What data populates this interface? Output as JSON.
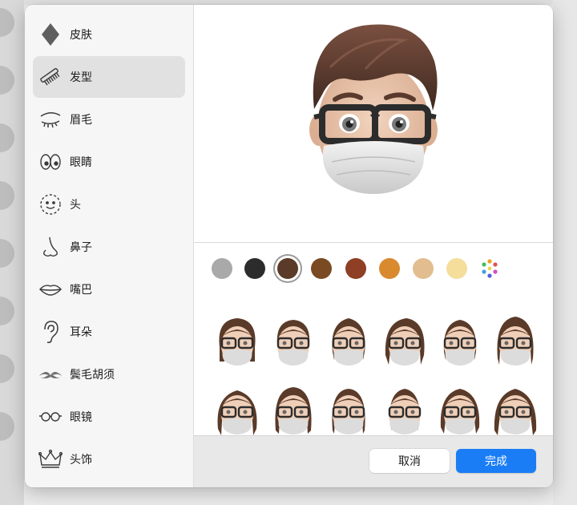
{
  "sidebar": {
    "items": [
      {
        "label": "皮肤",
        "icon": "skin-diamond-icon"
      },
      {
        "label": "发型",
        "icon": "comb-icon"
      },
      {
        "label": "眉毛",
        "icon": "eyebrow-icon"
      },
      {
        "label": "眼睛",
        "icon": "eyes-icon"
      },
      {
        "label": "头",
        "icon": "head-icon"
      },
      {
        "label": "鼻子",
        "icon": "nose-icon"
      },
      {
        "label": "嘴巴",
        "icon": "mouth-icon"
      },
      {
        "label": "耳朵",
        "icon": "ear-icon"
      },
      {
        "label": "鬓毛胡须",
        "icon": "mustache-icon"
      },
      {
        "label": "眼镜",
        "icon": "glasses-icon"
      },
      {
        "label": "头饰",
        "icon": "crown-icon"
      }
    ],
    "selected": "发型"
  },
  "hair_colors": [
    {
      "name": "gray",
      "hex": "#a9a9a9"
    },
    {
      "name": "black",
      "hex": "#2c2c2c"
    },
    {
      "name": "dark-brown",
      "hex": "#5a3a28",
      "selected": true
    },
    {
      "name": "brown",
      "hex": "#7a4a22"
    },
    {
      "name": "auburn",
      "hex": "#8e3f24"
    },
    {
      "name": "orange",
      "hex": "#d98a2f"
    },
    {
      "name": "tan",
      "hex": "#e2bd8f"
    },
    {
      "name": "blonde",
      "hex": "#f5dd9b"
    },
    {
      "name": "more-colors",
      "icon": "color-palette-icon"
    }
  ],
  "hairstyles_count_visible": 12,
  "buttons": {
    "cancel": "取消",
    "done": "完成"
  },
  "colors": {
    "accent": "#1a7df5",
    "selected_row": "#e1e1e1",
    "sidebar_bg": "#f6f6f6",
    "footer_bg": "#e9e8e8"
  }
}
